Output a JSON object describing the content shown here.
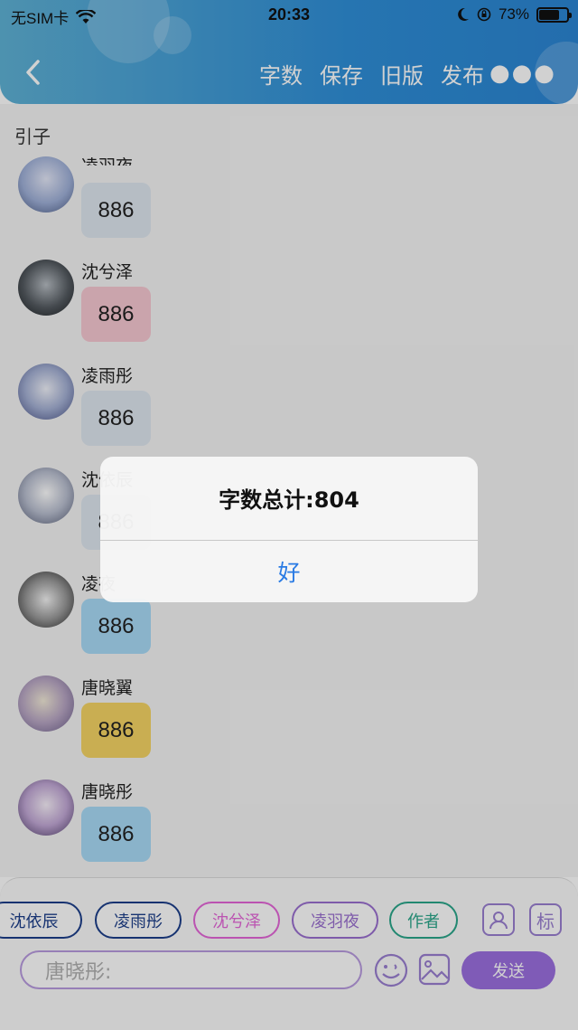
{
  "status_bar": {
    "carrier": "无SIM卡",
    "time": "20:33",
    "battery": "73%",
    "battery_level": 0.73,
    "icons": [
      "wifi-icon",
      "moon-icon",
      "orientation-lock-icon",
      "battery-icon"
    ]
  },
  "header": {
    "back_icon": "chevron-left-icon",
    "actions": [
      "字数",
      "保存",
      "旧版",
      "发布"
    ],
    "more_icon": "more-icon",
    "colors": {
      "start": "#5fb2d6",
      "end": "#2b86d4"
    }
  },
  "content": {
    "section_label": "引子",
    "messages": [
      {
        "name": "凌羽夜",
        "text": "886",
        "color": "#dfe7f0"
      },
      {
        "name": "沈兮泽",
        "text": "886",
        "color": "#f7c8d2"
      },
      {
        "name": "凌雨彤",
        "text": "886",
        "color": "#dfe7f0"
      },
      {
        "name": "沈依辰",
        "text": "886",
        "color": "#dfe7f0"
      },
      {
        "name": "凌夜",
        "text": "886",
        "color": "#a9dbf7"
      },
      {
        "name": "唐晓翼",
        "text": "886",
        "color": "#f6d565"
      },
      {
        "name": "唐晓彤",
        "text": "886",
        "color": "#a9dbf7"
      }
    ]
  },
  "bottom_bar": {
    "chips": [
      {
        "label": "沈依辰",
        "color": "#1d3f8a"
      },
      {
        "label": "凌雨彤",
        "color": "#1d3f8a"
      },
      {
        "label": "沈兮泽",
        "color": "#e466d8"
      },
      {
        "label": "凌羽夜",
        "color": "#9a6fd0"
      },
      {
        "label": "作者",
        "color": "#2aa68a"
      }
    ],
    "contact_icon": "contact-card-icon",
    "tag_button": "标",
    "input_placeholder": "唐晓彤:",
    "emoji_icon": "emoji-icon",
    "image_icon": "image-icon",
    "send_label": "发送"
  },
  "dialog": {
    "message": "字数总计:804",
    "button": "好"
  }
}
